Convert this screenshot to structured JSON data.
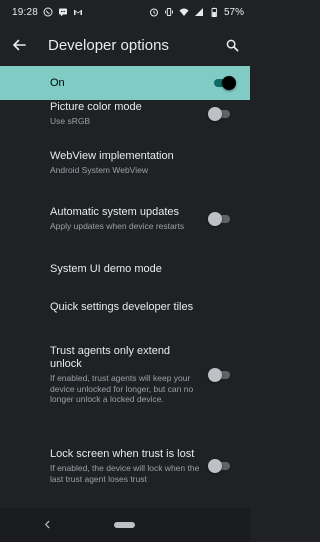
{
  "status_bar": {
    "time": "19:28",
    "notification_icons": [
      "whatsapp-icon",
      "messages-icon",
      "gmail-icon"
    ],
    "system_icons": [
      "alarm-icon",
      "vibrate-icon",
      "wifi-icon",
      "signal-icon",
      "battery-icon"
    ],
    "battery_percent": "57%"
  },
  "app_bar": {
    "title": "Developer options"
  },
  "master_switch": {
    "label": "On",
    "checked": true,
    "accent_color": "#80cbc4"
  },
  "settings": [
    {
      "title": "Picture color mode",
      "summary": "Use sRGB",
      "has_toggle": true,
      "checked": false
    },
    {
      "title": "WebView implementation",
      "summary": "Android System WebView",
      "has_toggle": false
    },
    {
      "title": "Automatic system updates",
      "summary": "Apply updates when device restarts",
      "has_toggle": true,
      "checked": false
    },
    {
      "title": "System UI demo mode",
      "summary": "",
      "has_toggle": false
    },
    {
      "title": "Quick settings developer tiles",
      "summary": "",
      "has_toggle": false
    },
    {
      "title": "Trust agents only extend unlock",
      "summary": "If enabled, trust agents will keep your device unlocked for longer, but can no longer unlock a locked device.",
      "has_toggle": true,
      "checked": false
    },
    {
      "title": "Lock screen when trust is lost",
      "summary": "If enabled, the device will lock when the last trust agent loses trust",
      "has_toggle": true,
      "checked": false
    }
  ]
}
